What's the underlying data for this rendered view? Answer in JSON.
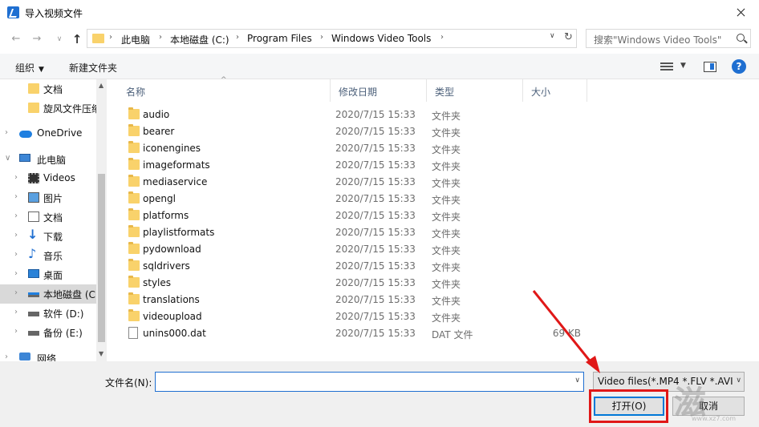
{
  "window": {
    "title": "导入视频文件",
    "close_glyph": ""
  },
  "nav": {
    "back": "←",
    "forward": "→",
    "recent": "∨",
    "up": "↑"
  },
  "address": {
    "sep": "›",
    "crumbs": [
      "此电脑",
      "本地磁盘 (C:)",
      "Program Files",
      "Windows Video Tools"
    ],
    "dropdown": "∨",
    "refresh": "↻"
  },
  "search": {
    "placeholder": "搜索\"Windows Video Tools\""
  },
  "toolbar": {
    "organize": "组织",
    "organize_caret": "▼",
    "new_folder": "新建文件夹",
    "view_caret": "▼",
    "help": "?"
  },
  "navpane": {
    "items": [
      {
        "label": "文档",
        "icon": "folder-icon",
        "chev": ""
      },
      {
        "label": "旋风文件压缩",
        "icon": "folder-icon",
        "chev": ""
      },
      {
        "label": "OneDrive",
        "icon": "onedrive-icon",
        "chev": "›"
      },
      {
        "label": "此电脑",
        "icon": "this-pc-icon",
        "chev": "∨"
      },
      {
        "label": "Videos",
        "icon": "videos-icon",
        "chev": "›"
      },
      {
        "label": "图片",
        "icon": "pictures-icon",
        "chev": "›"
      },
      {
        "label": "文档",
        "icon": "documents-icon",
        "chev": "›"
      },
      {
        "label": "下载",
        "icon": "download-icon",
        "chev": "›"
      },
      {
        "label": "音乐",
        "icon": "music-icon",
        "chev": "›"
      },
      {
        "label": "桌面",
        "icon": "desktop-icon",
        "chev": "›"
      },
      {
        "label": "本地磁盘 (C:)",
        "icon": "drive-c-icon",
        "chev": "›"
      },
      {
        "label": "软件 (D:)",
        "icon": "drive-icon",
        "chev": "›"
      },
      {
        "label": "备份 (E:)",
        "icon": "drive-icon",
        "chev": "›"
      },
      {
        "label": "网络",
        "icon": "network-icon",
        "chev": "›"
      }
    ],
    "selected_index": 10,
    "scroll_up": "▲",
    "scroll_down": "▼"
  },
  "columns": {
    "name": "名称",
    "date": "修改日期",
    "type": "类型",
    "size": "大小",
    "sort_glyph": "^"
  },
  "files": [
    {
      "name": "audio",
      "date": "2020/7/15 15:33",
      "type": "文件夹",
      "size": "",
      "kind": "folder"
    },
    {
      "name": "bearer",
      "date": "2020/7/15 15:33",
      "type": "文件夹",
      "size": "",
      "kind": "folder"
    },
    {
      "name": "iconengines",
      "date": "2020/7/15 15:33",
      "type": "文件夹",
      "size": "",
      "kind": "folder"
    },
    {
      "name": "imageformats",
      "date": "2020/7/15 15:33",
      "type": "文件夹",
      "size": "",
      "kind": "folder"
    },
    {
      "name": "mediaservice",
      "date": "2020/7/15 15:33",
      "type": "文件夹",
      "size": "",
      "kind": "folder"
    },
    {
      "name": "opengl",
      "date": "2020/7/15 15:33",
      "type": "文件夹",
      "size": "",
      "kind": "folder"
    },
    {
      "name": "platforms",
      "date": "2020/7/15 15:33",
      "type": "文件夹",
      "size": "",
      "kind": "folder"
    },
    {
      "name": "playlistformats",
      "date": "2020/7/15 15:33",
      "type": "文件夹",
      "size": "",
      "kind": "folder"
    },
    {
      "name": "pydownload",
      "date": "2020/7/15 15:33",
      "type": "文件夹",
      "size": "",
      "kind": "folder"
    },
    {
      "name": "sqldrivers",
      "date": "2020/7/15 15:33",
      "type": "文件夹",
      "size": "",
      "kind": "folder"
    },
    {
      "name": "styles",
      "date": "2020/7/15 15:33",
      "type": "文件夹",
      "size": "",
      "kind": "folder"
    },
    {
      "name": "translations",
      "date": "2020/7/15 15:33",
      "type": "文件夹",
      "size": "",
      "kind": "folder"
    },
    {
      "name": "videoupload",
      "date": "2020/7/15 15:33",
      "type": "文件夹",
      "size": "",
      "kind": "folder"
    },
    {
      "name": "unins000.dat",
      "date": "2020/7/15 15:33",
      "type": "DAT 文件",
      "size": "69 KB",
      "kind": "file"
    }
  ],
  "footer": {
    "filename_label": "文件名(N):",
    "filename_value": "",
    "filename_dropdown": "∨",
    "filter_value": "Video files(*.MP4 *.FLV *.AVI",
    "filter_dropdown": "∨",
    "open_label": "打开(O)",
    "cancel_label": "取消"
  },
  "annotation": {
    "color": "#e01818"
  },
  "watermark": {
    "url": "www.xz7.com"
  }
}
